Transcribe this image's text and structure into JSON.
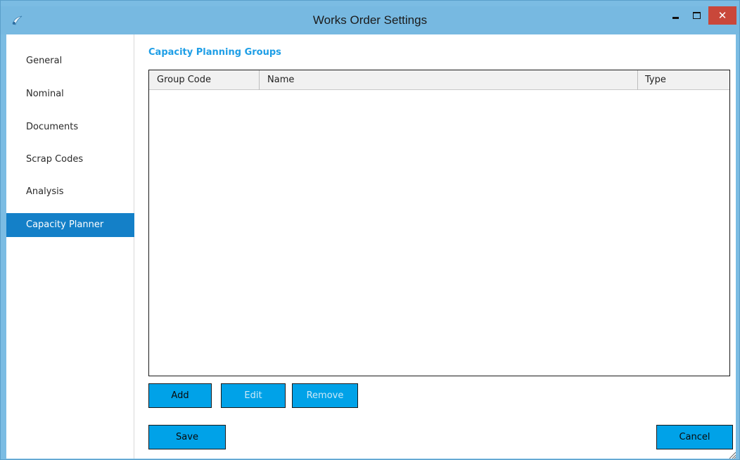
{
  "window": {
    "title": "Works Order Settings",
    "minimize_glyph": "–",
    "close_glyph": "✕"
  },
  "nav": {
    "items": [
      {
        "label": "General",
        "active": false
      },
      {
        "label": "Nominal",
        "active": false
      },
      {
        "label": "Documents",
        "active": false
      },
      {
        "label": "Scrap Codes",
        "active": false
      },
      {
        "label": "Analysis",
        "active": false
      },
      {
        "label": "Capacity Planner",
        "active": true
      }
    ]
  },
  "main": {
    "section_title": "Capacity Planning Groups",
    "grid": {
      "columns": [
        "Group Code",
        "Name",
        "Type"
      ],
      "rows": []
    },
    "buttons": {
      "add": "Add",
      "edit": "Edit",
      "remove": "Remove",
      "save": "Save",
      "cancel": "Cancel"
    }
  },
  "colors": {
    "titlebar": "#77b9e1",
    "accent": "#00a2e8",
    "nav_active": "#1480c8",
    "section_title": "#1e9ee6",
    "close_button": "#c9473a"
  }
}
